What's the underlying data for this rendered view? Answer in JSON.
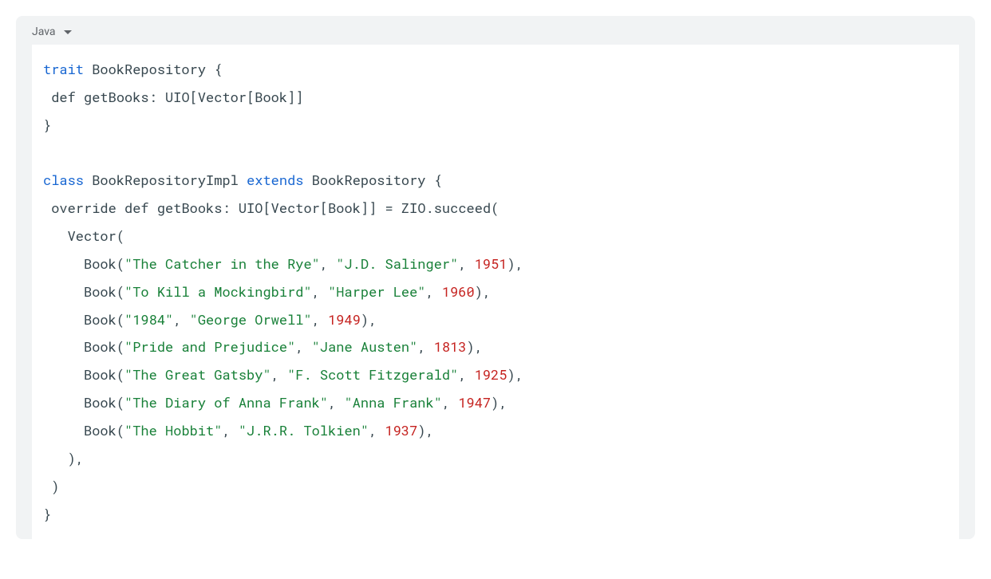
{
  "header": {
    "language": "Java"
  },
  "code": {
    "kw_trait": "trait",
    "kw_class": "class",
    "kw_extends": "extends",
    "kw_def": "def",
    "kw_override": "override",
    "trait_name": "BookRepository",
    "impl_name": "BookRepositoryImpl",
    "method_name": "getBooks",
    "ret_type": "UIO[Vector[Book]]",
    "zio_call": "ZIO.succeed(",
    "vector_open": "Vector(",
    "book_call": "Book",
    "books": [
      {
        "title": "\"The Catcher in the Rye\"",
        "author": "\"J.D. Salinger\"",
        "year": "1951"
      },
      {
        "title": "\"To Kill a Mockingbird\"",
        "author": "\"Harper Lee\"",
        "year": "1960"
      },
      {
        "title": "\"1984\"",
        "author": "\"George Orwell\"",
        "year": "1949"
      },
      {
        "title": "\"Pride and Prejudice\"",
        "author": "\"Jane Austen\"",
        "year": "1813"
      },
      {
        "title": "\"The Great Gatsby\"",
        "author": "\"F. Scott Fitzgerald\"",
        "year": "1925"
      },
      {
        "title": "\"The Diary of Anna Frank\"",
        "author": "\"Anna Frank\"",
        "year": "1947"
      },
      {
        "title": "\"The Hobbit\"",
        "author": "\"J.R.R. Tolkien\"",
        "year": "1937"
      }
    ]
  }
}
